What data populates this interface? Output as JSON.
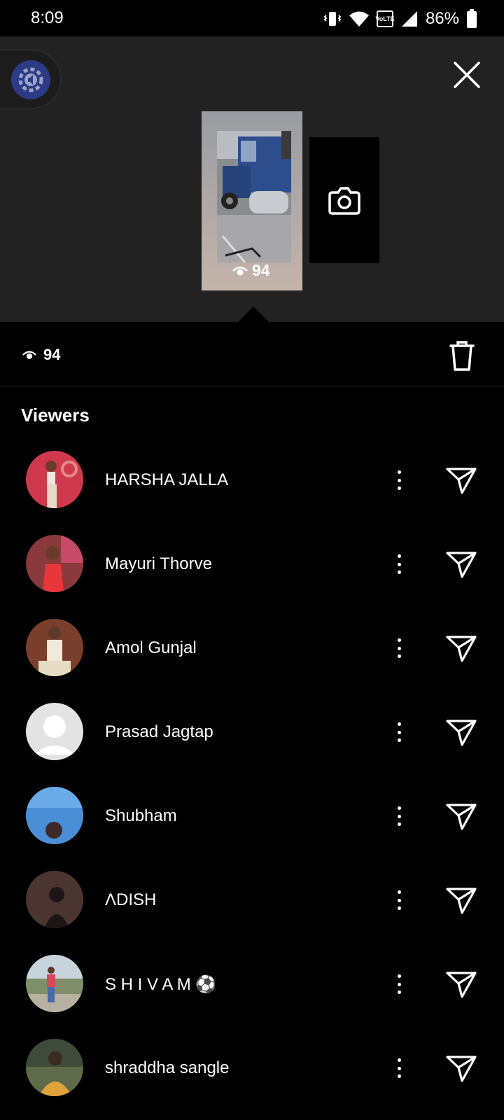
{
  "status_bar": {
    "time": "8:09",
    "battery": "86%",
    "lte_label": "VoLTE"
  },
  "story": {
    "view_count": "94"
  },
  "summary": {
    "view_count": "94"
  },
  "viewers_title": "Viewers",
  "viewers": [
    {
      "name": "HARSHA JALLA",
      "avatar_color": "#d0394d"
    },
    {
      "name": "Mayuri Thorve",
      "avatar_color": "#b93b4e"
    },
    {
      "name": "Amol Gunjal",
      "avatar_color": "#7a3f2c"
    },
    {
      "name": "Prasad Jagtap",
      "avatar_color": "#e3e3e3"
    },
    {
      "name": "Shubham",
      "avatar_color": "#4a8fd6"
    },
    {
      "name": "ΛDISH",
      "avatar_color": "#4a3530"
    },
    {
      "name": "S H I V A M ⚽",
      "avatar_color": "#7e8f6a"
    },
    {
      "name": "shraddha sangle",
      "avatar_color": "#5e6a4a"
    }
  ],
  "colors": {
    "background": "#000000",
    "top_panel": "#222222",
    "audio_button": "#2d3a85"
  },
  "icons": {
    "close": "close-icon",
    "camera": "camera-icon",
    "trash": "trash-icon",
    "eye": "eye-icon",
    "more": "more-vertical-icon",
    "send": "send-icon"
  }
}
